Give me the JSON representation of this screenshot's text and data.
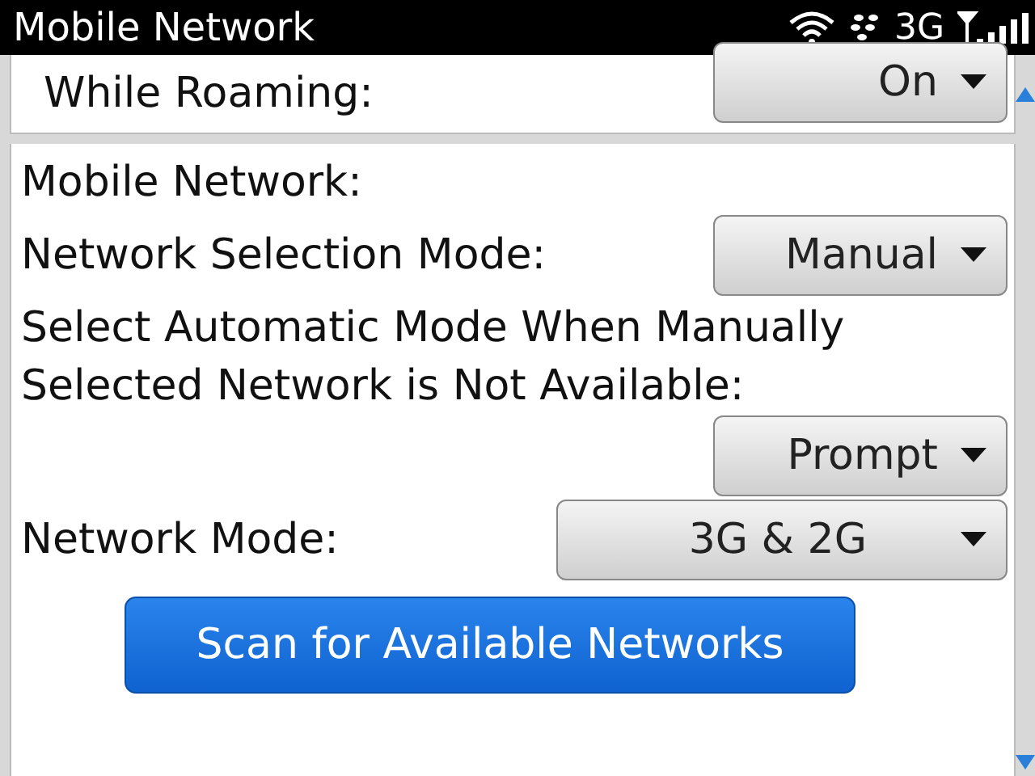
{
  "status_bar": {
    "title": "Mobile Network",
    "network_type": "3G"
  },
  "roaming_section": {
    "label": "While Roaming:",
    "dropdown": {
      "value": "On"
    }
  },
  "mobile_network_section": {
    "heading": "Mobile Network:",
    "settings": [
      {
        "label": "Network Selection Mode:",
        "value": "Manual",
        "kind": "inline"
      },
      {
        "label": "Select Automatic Mode When Manually Selected Network is Not Available:",
        "value": "Prompt",
        "kind": "below"
      },
      {
        "label": "Network Mode:",
        "value": "3G & 2G",
        "kind": "wide"
      }
    ],
    "scan_button": "Scan for Available Networks"
  }
}
